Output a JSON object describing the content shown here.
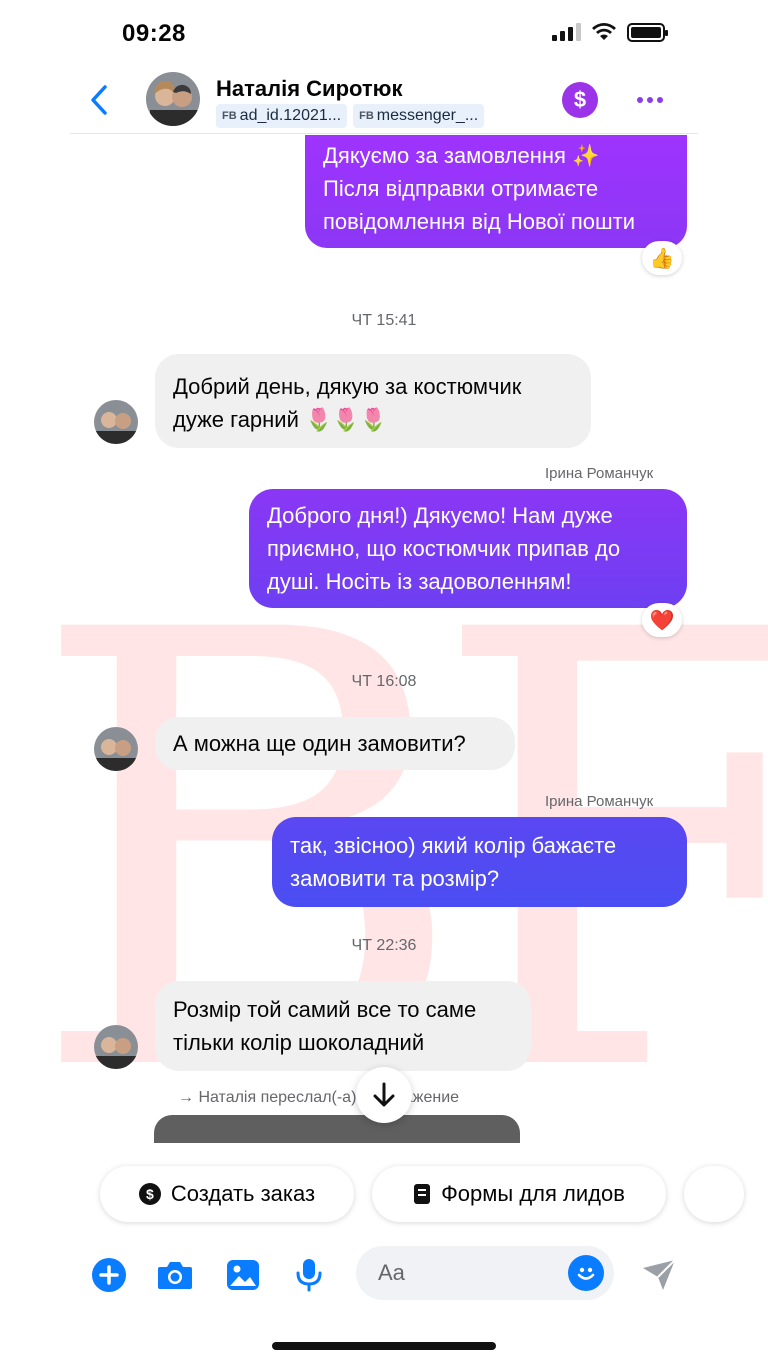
{
  "status_bar": {
    "time": "09:28"
  },
  "header": {
    "contact_name": "Наталія Сиротюк",
    "chips": [
      {
        "prefix": "FB",
        "text": "ad_id.12021..."
      },
      {
        "prefix": "FB",
        "text": "messenger_..."
      }
    ],
    "dollar_symbol": "$"
  },
  "messages": [
    {
      "type": "out",
      "lines": [
        "Дякуємо за замовлення ✨",
        "Після відправки отримаєте",
        "повідомлення від Нової пошти"
      ],
      "reaction": "👍"
    },
    {
      "type": "timestamp",
      "text": "ЧТ 15:41"
    },
    {
      "type": "in",
      "lines": [
        "Добрий день, дякую за костюмчик",
        "дуже гарний 🌷🌷🌷"
      ]
    },
    {
      "type": "out",
      "sender": "Ірина Романчук",
      "lines": [
        "Доброго дня!) Дякуємо! Нам дуже",
        "приємно, що костюмчик припав до",
        "душі. Носіть із задоволенням!"
      ],
      "reaction": "❤️"
    },
    {
      "type": "timestamp",
      "text": "ЧТ 16:08"
    },
    {
      "type": "in",
      "lines": [
        "А можна ще один замовити?"
      ]
    },
    {
      "type": "out",
      "sender": "Ірина Романчук",
      "lines": [
        "так, звісноо) який колір бажаєте",
        "замовити та розмір?"
      ]
    },
    {
      "type": "timestamp",
      "text": "ЧТ 22:36"
    },
    {
      "type": "in",
      "lines": [
        "Розмір той самий все то саме",
        "тільки колір шоколадний"
      ]
    }
  ],
  "forward_note": "→ Наталія переслал(-а) изображение",
  "watermark": "BF",
  "quick_actions": [
    {
      "icon": "dollar-icon",
      "label": "Создать заказ"
    },
    {
      "icon": "form-icon",
      "label": "Формы для лидов"
    }
  ],
  "composer": {
    "placeholder": "Aa"
  },
  "colors": {
    "accent_blue": "#0a7cff",
    "accent_purple": "#9b33e8",
    "bubble_in": "#f0f0f0",
    "bubble_out_top": "#a033ff",
    "bubble_out_mid": "#7a3cf2",
    "bubble_out_bottom": "#4a4ef2"
  }
}
